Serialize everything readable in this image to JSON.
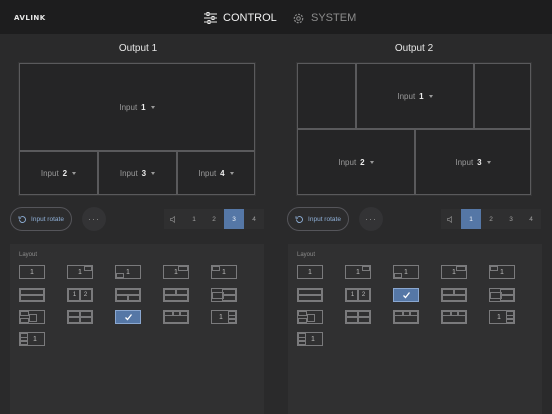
{
  "app": {
    "logo_text": "AVLINK"
  },
  "nav": {
    "control_label": "CONTROL",
    "system_label": "SYSTEM"
  },
  "outputs": [
    {
      "title": "Output 1",
      "windows": [
        {
          "prefix": "Input",
          "num": "1"
        },
        {
          "prefix": "Input",
          "num": "2"
        },
        {
          "prefix": "Input",
          "num": "3"
        },
        {
          "prefix": "Input",
          "num": "4"
        }
      ],
      "rotate_label": "Input rotate",
      "more_label": "···",
      "pages": [
        "1",
        "2",
        "3",
        "4"
      ],
      "active_page": "3",
      "layout_label": "Layout",
      "selected_layout_index": 13
    },
    {
      "title": "Output 2",
      "windows": [
        {
          "prefix": "Input",
          "num": "1"
        },
        {
          "prefix": "Input",
          "num": "2"
        },
        {
          "prefix": "Input",
          "num": "3"
        }
      ],
      "rotate_label": "Input rotate",
      "more_label": "···",
      "pages": [
        "1",
        "2",
        "3",
        "4"
      ],
      "active_page": "1",
      "layout_label": "Layout",
      "selected_layout_index": 7
    }
  ],
  "layout_thumbnails": [
    "1",
    "1",
    "1",
    "1",
    "1",
    "",
    "1 2",
    "",
    "",
    "",
    "",
    "",
    "",
    "",
    "1",
    "1"
  ],
  "colors": {
    "accent": "#5577a6",
    "background": "#2a2a2b",
    "topbar": "#1d1d1e"
  }
}
